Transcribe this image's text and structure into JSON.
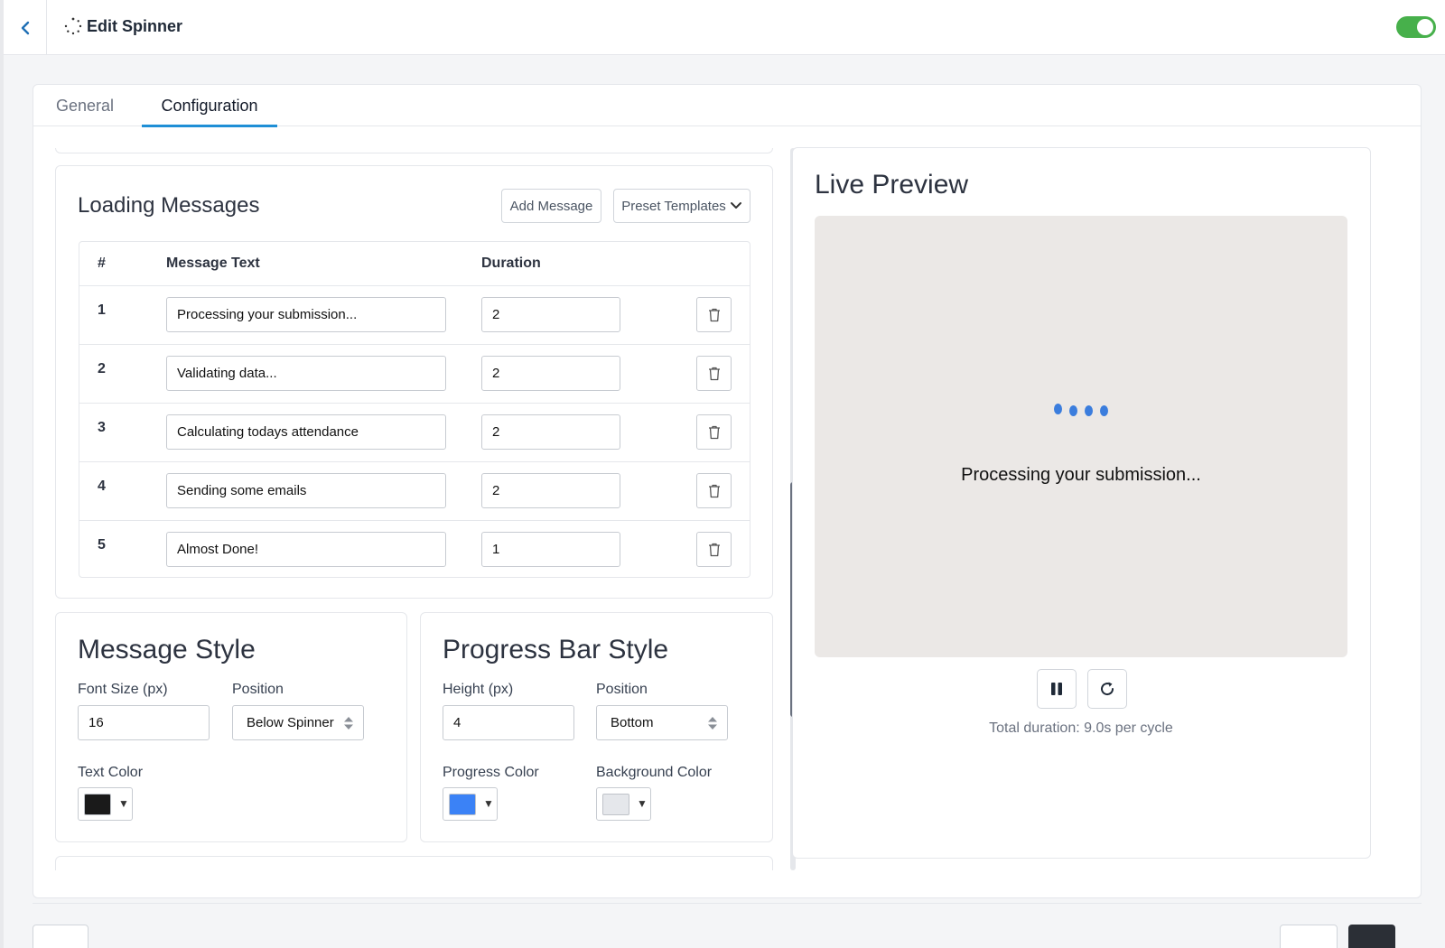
{
  "header": {
    "title": "Edit Spinner",
    "enabled": true,
    "accent_color": "#47b04b"
  },
  "tabs": [
    {
      "label": "General",
      "active": false
    },
    {
      "label": "Configuration",
      "active": true
    }
  ],
  "loading_messages": {
    "title": "Loading Messages",
    "add_button": "Add Message",
    "preset_button": "Preset Templates",
    "columns": {
      "num": "#",
      "text": "Message Text",
      "duration": "Duration"
    },
    "rows": [
      {
        "num": "1",
        "text": "Processing your submission...",
        "duration": "2"
      },
      {
        "num": "2",
        "text": "Validating data...",
        "duration": "2"
      },
      {
        "num": "3",
        "text": "Calculating todays attendance",
        "duration": "2"
      },
      {
        "num": "4",
        "text": "Sending some emails",
        "duration": "2"
      },
      {
        "num": "5",
        "text": "Almost Done!",
        "duration": "1"
      }
    ]
  },
  "message_style": {
    "title": "Message Style",
    "font_size_label": "Font Size (px)",
    "font_size_value": "16",
    "position_label": "Position",
    "position_value": "Below Spinner",
    "text_color_label": "Text Color",
    "text_color": "#1a1a1a"
  },
  "progress_bar_style": {
    "title": "Progress Bar Style",
    "height_label": "Height (px)",
    "height_value": "4",
    "position_label": "Position",
    "position_value": "Bottom",
    "progress_color_label": "Progress Color",
    "progress_color": "#3b82f6",
    "background_color_label": "Background Color",
    "background_color": "#e5e7eb"
  },
  "live_preview": {
    "title": "Live Preview",
    "message": "Processing your submission...",
    "spinner_color": "#3b7ddd",
    "total_duration": "Total duration: 9.0s per cycle"
  }
}
